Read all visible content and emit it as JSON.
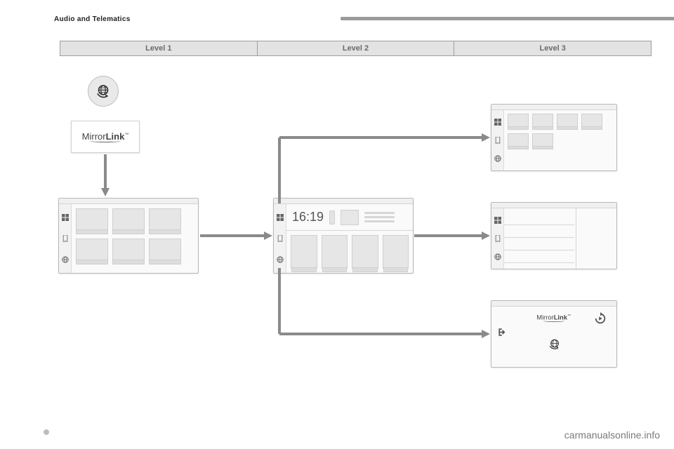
{
  "header": {
    "title": "Audio and Telematics"
  },
  "levels": {
    "l1": "Level 1",
    "l2": "Level 2",
    "l3": "Level 3"
  },
  "brand": {
    "mirror": "Mirror",
    "link": "Link",
    "tm": "™"
  },
  "center": {
    "time": "16:19"
  },
  "watermark": "carmanualsonline.info"
}
